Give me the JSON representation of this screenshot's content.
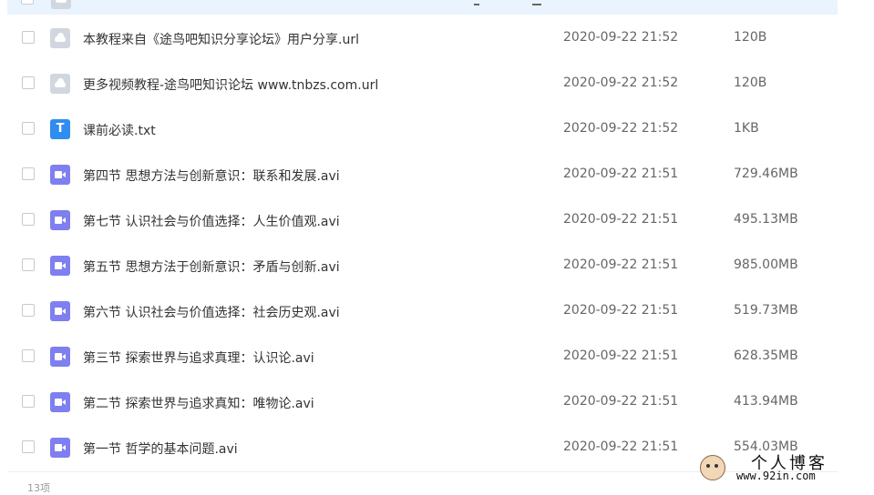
{
  "files": [
    {
      "name": "本教程来自《途鸟吧知识分享论坛》用户分享.url",
      "date": "2020-09-22 21:52",
      "size": "120B",
      "type": "url"
    },
    {
      "name": "更多视频教程-途鸟吧知识论坛 www.tnbzs.com.url",
      "date": "2020-09-22 21:52",
      "size": "120B",
      "type": "url"
    },
    {
      "name": "课前必读.txt",
      "date": "2020-09-22 21:52",
      "size": "1KB",
      "type": "txt"
    },
    {
      "name": "第四节 思想方法与创新意识：联系和发展.avi",
      "date": "2020-09-22 21:51",
      "size": "729.46MB",
      "type": "video"
    },
    {
      "name": "第七节 认识社会与价值选择：人生价值观.avi",
      "date": "2020-09-22 21:51",
      "size": "495.13MB",
      "type": "video"
    },
    {
      "name": "第五节 思想方法于创新意识：矛盾与创新.avi",
      "date": "2020-09-22 21:51",
      "size": "985.00MB",
      "type": "video"
    },
    {
      "name": "第六节 认识社会与价值选择：社会历史观.avi",
      "date": "2020-09-22 21:51",
      "size": "519.73MB",
      "type": "video"
    },
    {
      "name": "第三节 探索世界与追求真理：认识论.avi",
      "date": "2020-09-22 21:51",
      "size": "628.35MB",
      "type": "video"
    },
    {
      "name": "第二节 探索世界与追求真知：唯物论.avi",
      "date": "2020-09-22 21:51",
      "size": "413.94MB",
      "type": "video"
    },
    {
      "name": "第一节 哲学的基本问题.avi",
      "date": "2020-09-22 21:51",
      "size": "554.03MB",
      "type": "video"
    }
  ],
  "txt_icon_glyph": "T",
  "footer": {
    "count": "13项"
  },
  "watermark": {
    "title": "个人博客",
    "url": "www.92in.com"
  },
  "colors": {
    "selected_row": "#eaf4fe",
    "video_icon": "#7e7ff0",
    "txt_icon": "#2f8cf0",
    "url_icon": "#d1d7de"
  }
}
